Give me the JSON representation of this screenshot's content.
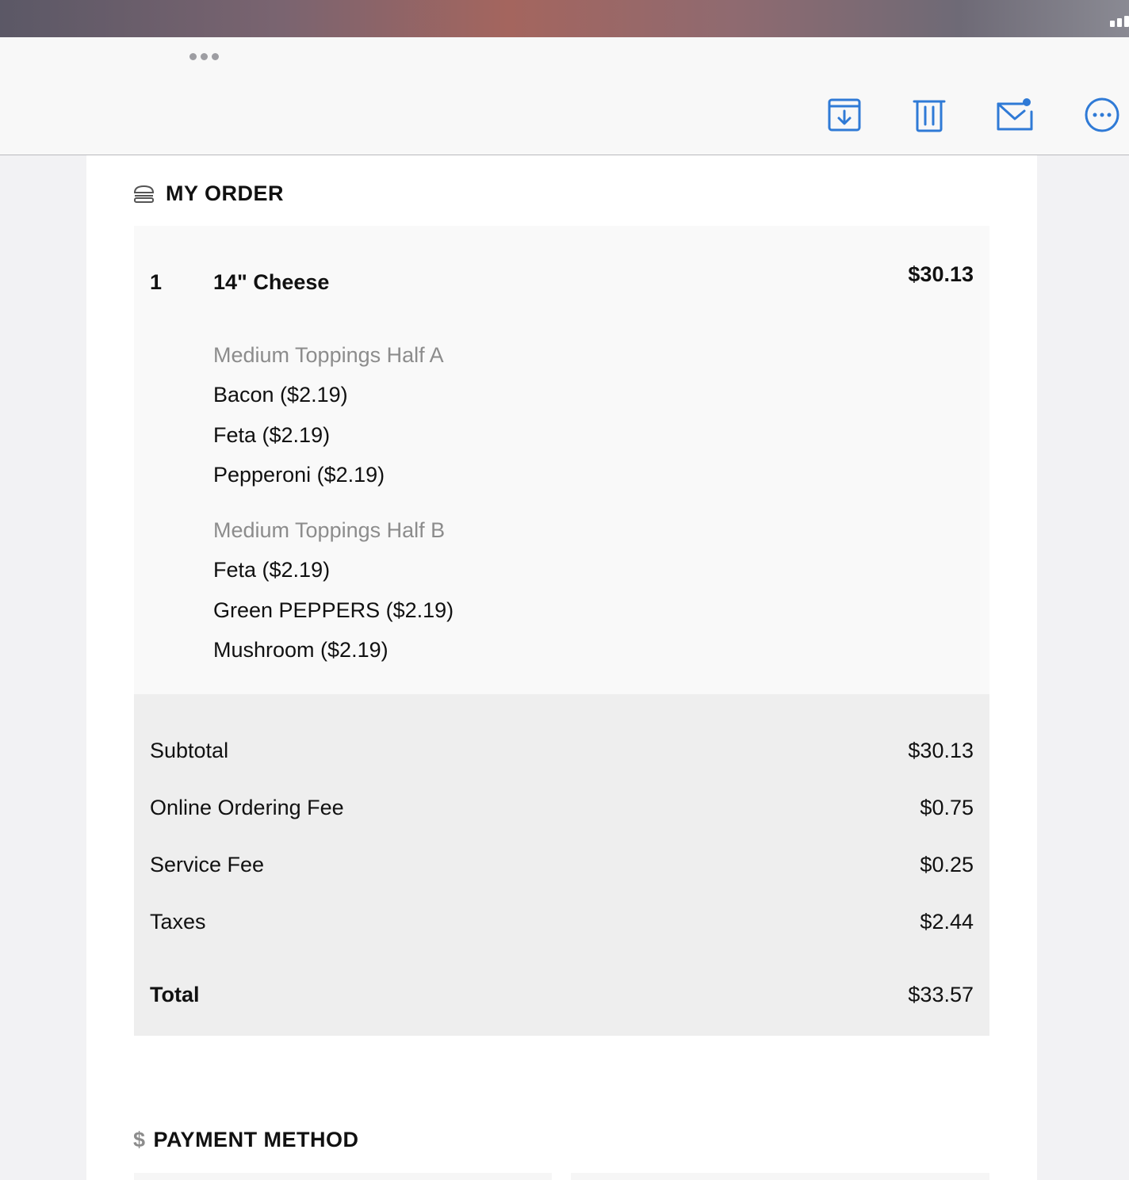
{
  "toolbar": {
    "icons": [
      "archive-icon",
      "trash-icon",
      "mail-icon",
      "more-icon"
    ]
  },
  "order": {
    "heading": "MY ORDER",
    "item": {
      "qty": "1",
      "name": "14\" Cheese",
      "price": "$30.13",
      "groups": [
        {
          "title": "Medium Toppings Half A",
          "options": [
            "Bacon ($2.19)",
            "Feta ($2.19)",
            "Pepperoni ($2.19)"
          ]
        },
        {
          "title": "Medium Toppings Half B",
          "options": [
            "Feta ($2.19)",
            "Green PEPPERS ($2.19)",
            "Mushroom ($2.19)"
          ]
        }
      ]
    },
    "totals": [
      {
        "label": "Subtotal",
        "value": "$30.13"
      },
      {
        "label": "Online Ordering Fee",
        "value": "$0.75"
      },
      {
        "label": "Service Fee",
        "value": "$0.25"
      },
      {
        "label": "Taxes",
        "value": "$2.44"
      },
      {
        "label": "Total",
        "value": "$33.57"
      }
    ]
  },
  "payment": {
    "icon_symbol": "$",
    "heading": "PAYMENT METHOD"
  },
  "colors": {
    "accent": "#2f7ad6",
    "muted_text": "#8c8c8c"
  }
}
